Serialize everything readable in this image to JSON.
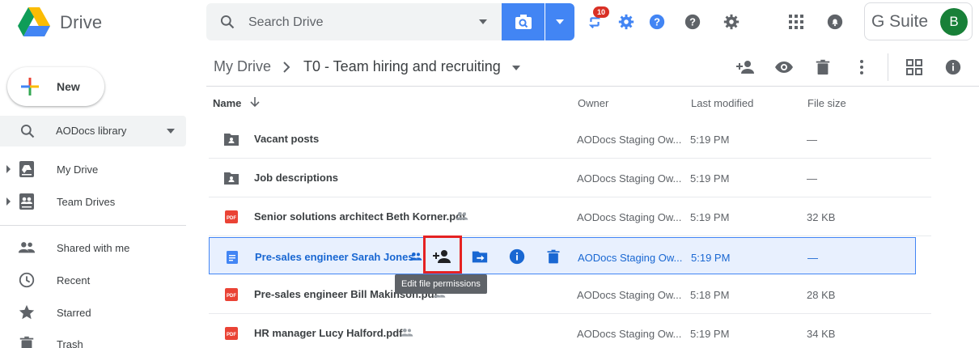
{
  "app": {
    "brand": "Drive"
  },
  "search": {
    "placeholder": "Search Drive"
  },
  "header": {
    "notifications_count": "10",
    "gsuite_label": "G Suite",
    "avatar_initial": "B"
  },
  "sidebar": {
    "new_label": "New",
    "library": "AODocs library",
    "items": [
      {
        "label": "My Drive"
      },
      {
        "label": "Team Drives"
      },
      {
        "label": "Shared with me"
      },
      {
        "label": "Recent"
      },
      {
        "label": "Starred"
      },
      {
        "label": "Trash"
      }
    ]
  },
  "breadcrumb": {
    "root": "My Drive",
    "current": "T0 - Team hiring and recruiting"
  },
  "table": {
    "columns": {
      "name": "Name",
      "owner": "Owner",
      "modified": "Last modified",
      "size": "File size"
    },
    "rows": [
      {
        "name": "Vacant posts",
        "type": "folder",
        "owner": "AODocs Staging Ow...",
        "modified": "5:19 PM",
        "size": "—"
      },
      {
        "name": "Job descriptions",
        "type": "folder",
        "owner": "AODocs Staging Ow...",
        "modified": "5:19 PM",
        "size": "—"
      },
      {
        "name": "Senior solutions architect Beth Korner.pdf",
        "type": "pdf",
        "owner": "AODocs Staging Ow...",
        "modified": "5:19 PM",
        "size": "32 KB"
      },
      {
        "name": "Pre-sales engineer Sarah Jones",
        "type": "doc",
        "owner": "AODocs Staging Ow...",
        "modified": "5:19 PM",
        "size": "—"
      },
      {
        "name": "Pre-sales engineer Bill Makinson.pdf",
        "type": "pdf",
        "owner": "AODocs Staging Ow...",
        "modified": "5:18 PM",
        "size": "28 KB"
      },
      {
        "name": "HR manager Lucy Halford.pdf",
        "type": "pdf",
        "owner": "AODocs Staging Ow...",
        "modified": "5:19 PM",
        "size": "34 KB"
      }
    ]
  },
  "tooltip": {
    "text": "Edit file permissions"
  },
  "colors": {
    "accent": "#4285f4",
    "selected_bg": "#e8f0fe",
    "selected_text": "#1967d2",
    "highlight": "#e52222",
    "pdf_red": "#ea4335"
  }
}
